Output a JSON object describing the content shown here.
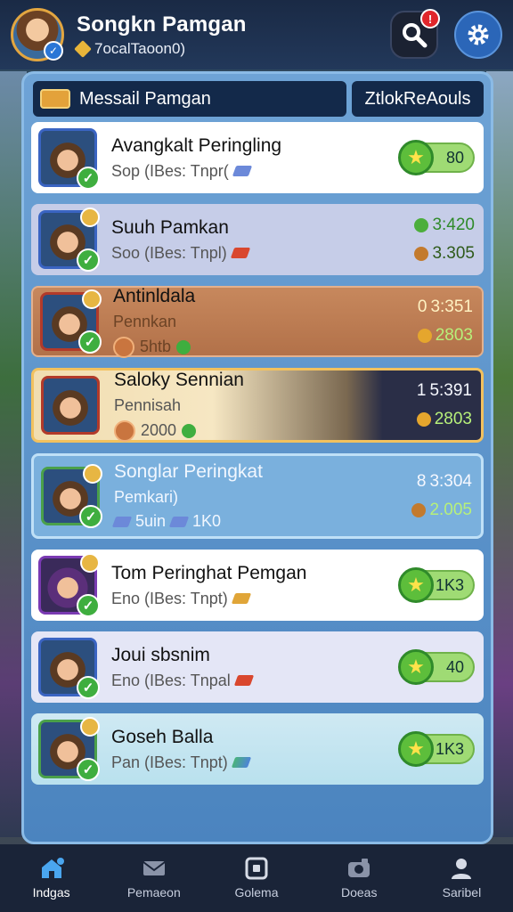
{
  "profile": {
    "name": "Songkn Pamgan",
    "sub": "7ocalTaoon0)",
    "avatar_badge": "✓"
  },
  "header": {
    "notification_count": "!"
  },
  "tabs": {
    "main_label": "Messail Pamgan",
    "alt_label": "ZtlokReAouls"
  },
  "rows": [
    {
      "name": "Avangkalt Peringling",
      "sub": "Sop (IBes: Tnpr(",
      "score": "80"
    },
    {
      "name": "Suuh Pamkan",
      "sub": "Soo (IBes: Tnpl)",
      "stat1": "3:420",
      "stat2": "3.305"
    },
    {
      "name": "Antinldala",
      "sub": "Pennkan",
      "extra": "5htb",
      "stat1": "3:351",
      "stat2": "2803",
      "rank": "0"
    },
    {
      "name": "Saloky Sennian",
      "sub": "Pennisah",
      "extra": "2000",
      "stat1": "5:391",
      "stat2": "2803",
      "rank": "1"
    },
    {
      "name": "Songlar Peringkat",
      "sub": "Pemkari)",
      "extra1": "5uin",
      "extra2": "1K0",
      "stat1": "3:304",
      "stat2": "2.005",
      "rank": "8"
    },
    {
      "name": "Tom Peringhat Pemgan",
      "sub": "Eno (IBes: Tnpt)",
      "score": "1K3"
    },
    {
      "name": "Joui sbsnim",
      "sub": "Eno (IBes: Tnpal",
      "score": "40"
    },
    {
      "name": "Goseh Balla",
      "sub": "Pan (IBes: Tnpt)",
      "score": "1K3"
    }
  ],
  "nav": [
    {
      "label": "Indgas",
      "icon": "home-icon",
      "active": true
    },
    {
      "label": "Pemaeon",
      "icon": "mail-icon"
    },
    {
      "label": "Golema",
      "icon": "square-icon"
    },
    {
      "label": "Doeas",
      "icon": "camera-icon"
    },
    {
      "label": "Saribel",
      "icon": "person-icon"
    }
  ],
  "colors": {
    "accent_blue": "#2b66b8",
    "score_green": "#9fdb74",
    "gold_border": "#f2c15e"
  }
}
